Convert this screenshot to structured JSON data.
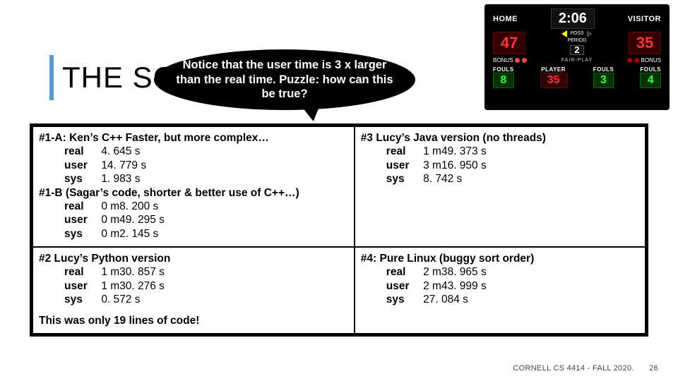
{
  "title": "THE SCOREBOARD",
  "callout": "Notice that the user time is 3 x larger than the real time.  Puzzle: how can this be true?",
  "scoreboard": {
    "home_lbl": "HOME",
    "visitor_lbl": "VISITOR",
    "clock": "2:06",
    "home_score": "47",
    "visitor_score": "35",
    "poss_lbl": "POSS",
    "period_lbl": "PERIOD",
    "period": "2",
    "bonus_lbl": "BONUS",
    "fairplay": "FAIR-PLAY",
    "fouls_lbl": "FOULS",
    "player_lbl": "PLAYER",
    "home_fouls": "8",
    "player": "35",
    "player_fouls": "3",
    "visitor_fouls": "4"
  },
  "cells": {
    "r1c1": {
      "h1": "#1-A:  Ken’s C++ Faster, but more complex…",
      "a_real": "4. 645 s",
      "a_user": "14. 779 s",
      "a_sys": "1. 983 s",
      "h2": "#1-B (Sagar’s code, shorter & better use of C++…)",
      "b_real": "0 m8. 200 s",
      "b_user": "0 m49. 295 s",
      "b_sys": "0 m2. 145 s"
    },
    "r1c2": {
      "h": "#3 Lucy’s Java version (no threads)",
      "real": "1 m49. 373 s",
      "user": "3 m16. 950 s",
      "sys": "8. 742 s"
    },
    "r2c1": {
      "h": "#2 Lucy’s Python version",
      "real": "1 m30. 857 s",
      "user": "1 m30. 276 s",
      "sys": "0. 572 s",
      "note": "This was only 19 lines of code!"
    },
    "r2c2": {
      "h": "#4: Pure Linux (buggy sort order)",
      "real": "2 m38. 965 s",
      "user": "2 m43. 999 s",
      "sys": "27. 084 s"
    }
  },
  "labels": {
    "real": "real",
    "user": "user",
    "sys": "sys"
  },
  "footer": {
    "course": "CORNELL CS 4414 - FALL 2020.",
    "page": "26"
  }
}
